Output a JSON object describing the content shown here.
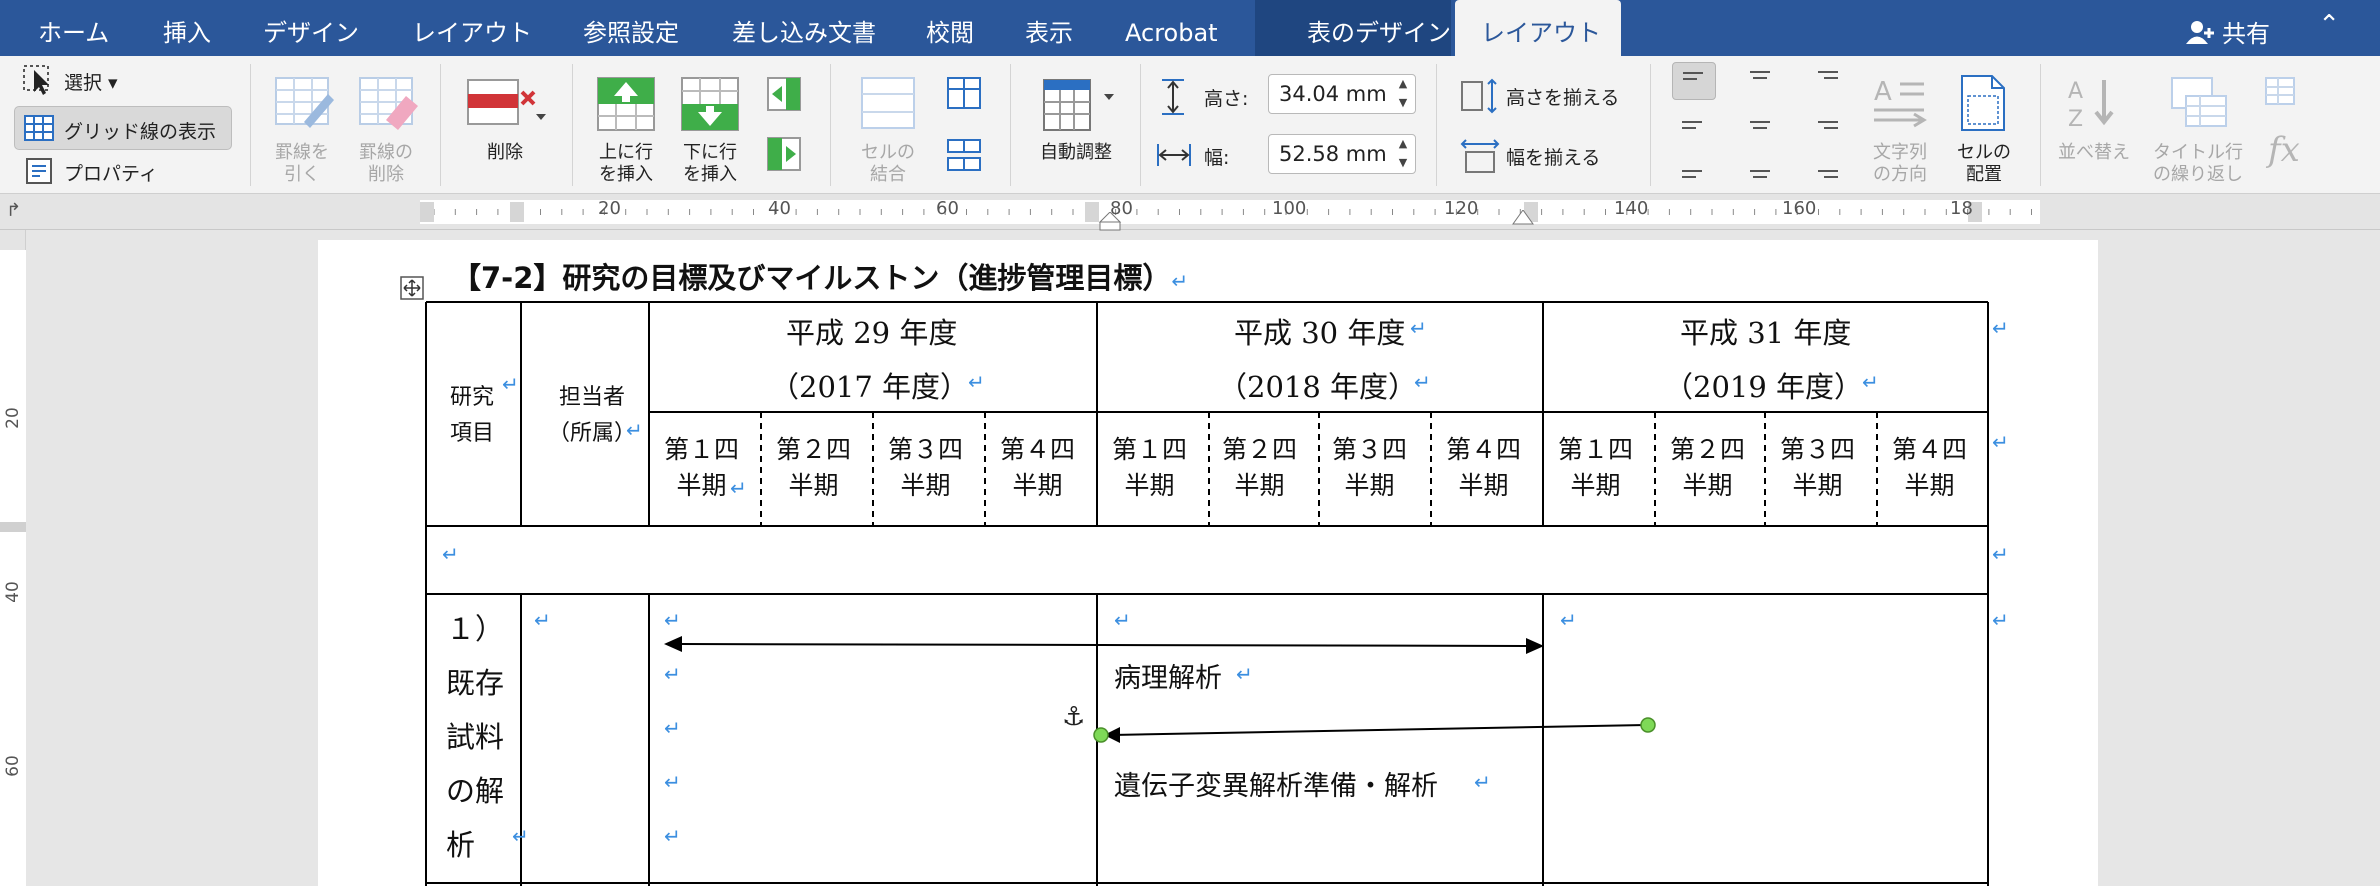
{
  "tabs": [
    {
      "label": "ホーム"
    },
    {
      "label": "挿入"
    },
    {
      "label": "デザイン"
    },
    {
      "label": "レイアウト"
    },
    {
      "label": "参照設定"
    },
    {
      "label": "差し込み文書"
    },
    {
      "label": "校閲"
    },
    {
      "label": "表示"
    },
    {
      "label": "Acrobat"
    },
    {
      "label": "表のデザイン"
    },
    {
      "label": "レイアウト"
    }
  ],
  "share_label": "共有",
  "ribbon": {
    "select_label": "選択",
    "gridlines_label": "グリッド線の表示",
    "properties_label": "プロパティ",
    "draw_borders_label": "罫線を\n引く",
    "erase_borders_label": "罫線の\n削除",
    "delete_label": "削除",
    "insert_above_label": "上に行\nを挿入",
    "insert_below_label": "下に行\nを挿入",
    "merge_cells_label": "セルの\n結合",
    "autofit_label": "自動調整",
    "height_label": "高さ:",
    "height_value": "34.04 mm",
    "width_label": "幅:",
    "width_value": "52.58 mm",
    "distribute_rows_label": "高さを揃える",
    "distribute_cols_label": "幅を揃える",
    "text_direction_label": "文字列\nの方向",
    "cell_margins_label": "セルの\n配置",
    "sort_label": "並べ替え",
    "repeat_header_label": "タイトル行\nの繰り返し"
  },
  "ruler_h_labels": [
    "20",
    "40",
    "60",
    "80",
    "100",
    "120",
    "140",
    "160",
    "18"
  ],
  "ruler_v_labels": [
    "20",
    "40",
    "60"
  ],
  "document": {
    "heading": "【7-2】研究の目標及びマイルストン（進捗管理目標）",
    "table": {
      "col1_header": "研究\n項目",
      "col2_header": "担当者\n（所属）",
      "years": [
        {
          "line1": "平成 29 年度",
          "line2": "（2017 年度）"
        },
        {
          "line1": "平成 30 年度",
          "line2": "（2018 年度）"
        },
        {
          "line1": "平成 31 年度",
          "line2": "（2019 年度）"
        }
      ],
      "quarters": [
        "第１四\n半期",
        "第２四\n半期",
        "第３四\n半期",
        "第４四\n半期"
      ],
      "row1_item": "１）\n既存\n試料\nの解\n析",
      "milestones": [
        "病理解析",
        "遺伝子変異解析準備・解析"
      ]
    }
  },
  "colors": {
    "tabbar": "#2b579a",
    "ribbon": "#f3f3f3",
    "paragraph_mark": "#3c8fe0",
    "handle_green": "#7ed957"
  }
}
